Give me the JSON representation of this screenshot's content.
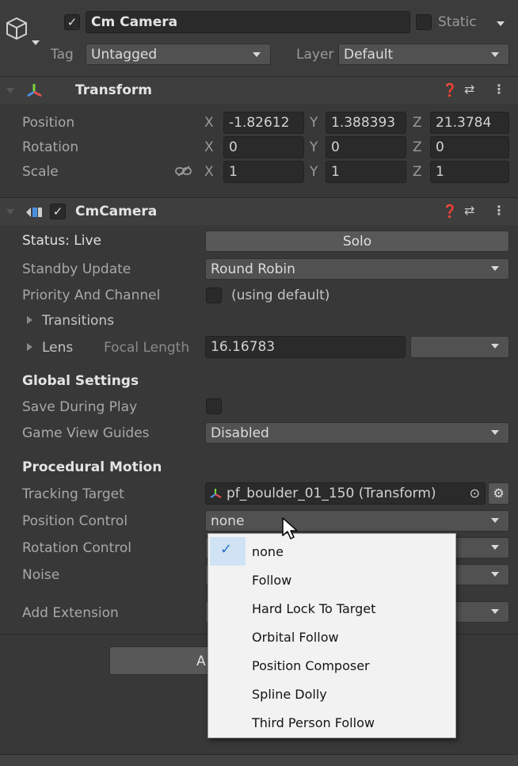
{
  "object": {
    "name": "Cm Camera",
    "enabled_mark": "✓",
    "static_label": "Static",
    "tag_label": "Tag",
    "tag_value": "Untagged",
    "layer_label": "Layer",
    "layer_value": "Default"
  },
  "transform": {
    "title": "Transform",
    "rows": [
      {
        "label": "Position",
        "x": "-1.82612",
        "y": "1.388393",
        "z": "21.3784"
      },
      {
        "label": "Rotation",
        "x": "0",
        "y": "0",
        "z": "0"
      },
      {
        "label": "Scale",
        "x": "1",
        "y": "1",
        "z": "1"
      }
    ],
    "axis_x": "X",
    "axis_y": "Y",
    "axis_z": "Z"
  },
  "cmcamera": {
    "title": "CmCamera",
    "enabled_mark": "✓",
    "status_label": "Status: Live",
    "solo_label": "Solo",
    "standby_label": "Standby Update",
    "standby_value": "Round Robin",
    "priority_label": "Priority And Channel",
    "priority_value": "(using default)",
    "transitions_label": "Transitions",
    "lens_label": "Lens",
    "focal_label": "Focal Length",
    "focal_value": "16.16783",
    "global_header": "Global Settings",
    "save_label": "Save During Play",
    "guides_label": "Game View Guides",
    "guides_value": "Disabled",
    "procedural_header": "Procedural Motion",
    "tracking_label": "Tracking Target",
    "tracking_value": "pf_boulder_01_150 (Transform)",
    "position_label": "Position Control",
    "position_value": "none",
    "rotation_label": "Rotation Control",
    "noise_label": "Noise",
    "extension_label": "Add Extension",
    "add_button_partial": "A"
  },
  "menu": {
    "check_mark": "✓",
    "items": [
      "none",
      "Follow",
      "Hard Lock To Target",
      "Orbital Follow",
      "Position Composer",
      "Spline Dolly",
      "Third Person Follow"
    ]
  }
}
